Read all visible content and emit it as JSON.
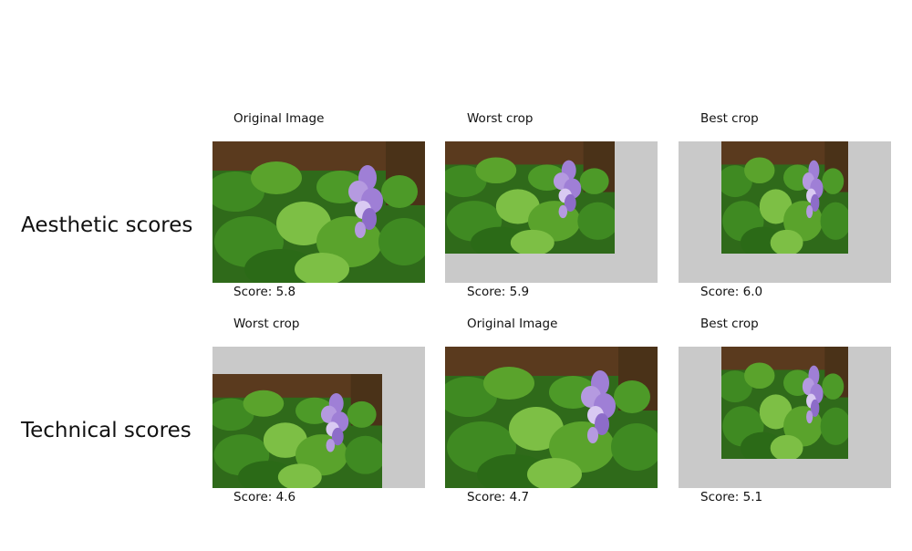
{
  "rows": [
    {
      "label": "Aesthetic scores",
      "cells": [
        {
          "title": "Original Image",
          "score": "Score: 5.8",
          "crop": "full"
        },
        {
          "title": "Worst crop",
          "score": "Score: 5.9",
          "crop": "top-left"
        },
        {
          "title": "Best crop",
          "score": "Score: 6.0",
          "crop": "top-center"
        }
      ]
    },
    {
      "label": "Technical scores",
      "cells": [
        {
          "title": "Worst crop",
          "score": "Score: 4.6",
          "crop": "bottom-left"
        },
        {
          "title": "Original Image",
          "score": "Score: 4.7",
          "crop": "full"
        },
        {
          "title": "Best crop",
          "score": "Score: 5.1",
          "crop": "top-center"
        }
      ]
    }
  ],
  "colors": {
    "padding": "#c9c9c9",
    "leaf_dark": "#1f4d12",
    "leaf_mid": "#3f8a22",
    "leaf_light": "#7dbf45",
    "soil": "#5a3a1e",
    "flower": "#9f7fd6",
    "flower_light": "#d9c9f2"
  }
}
